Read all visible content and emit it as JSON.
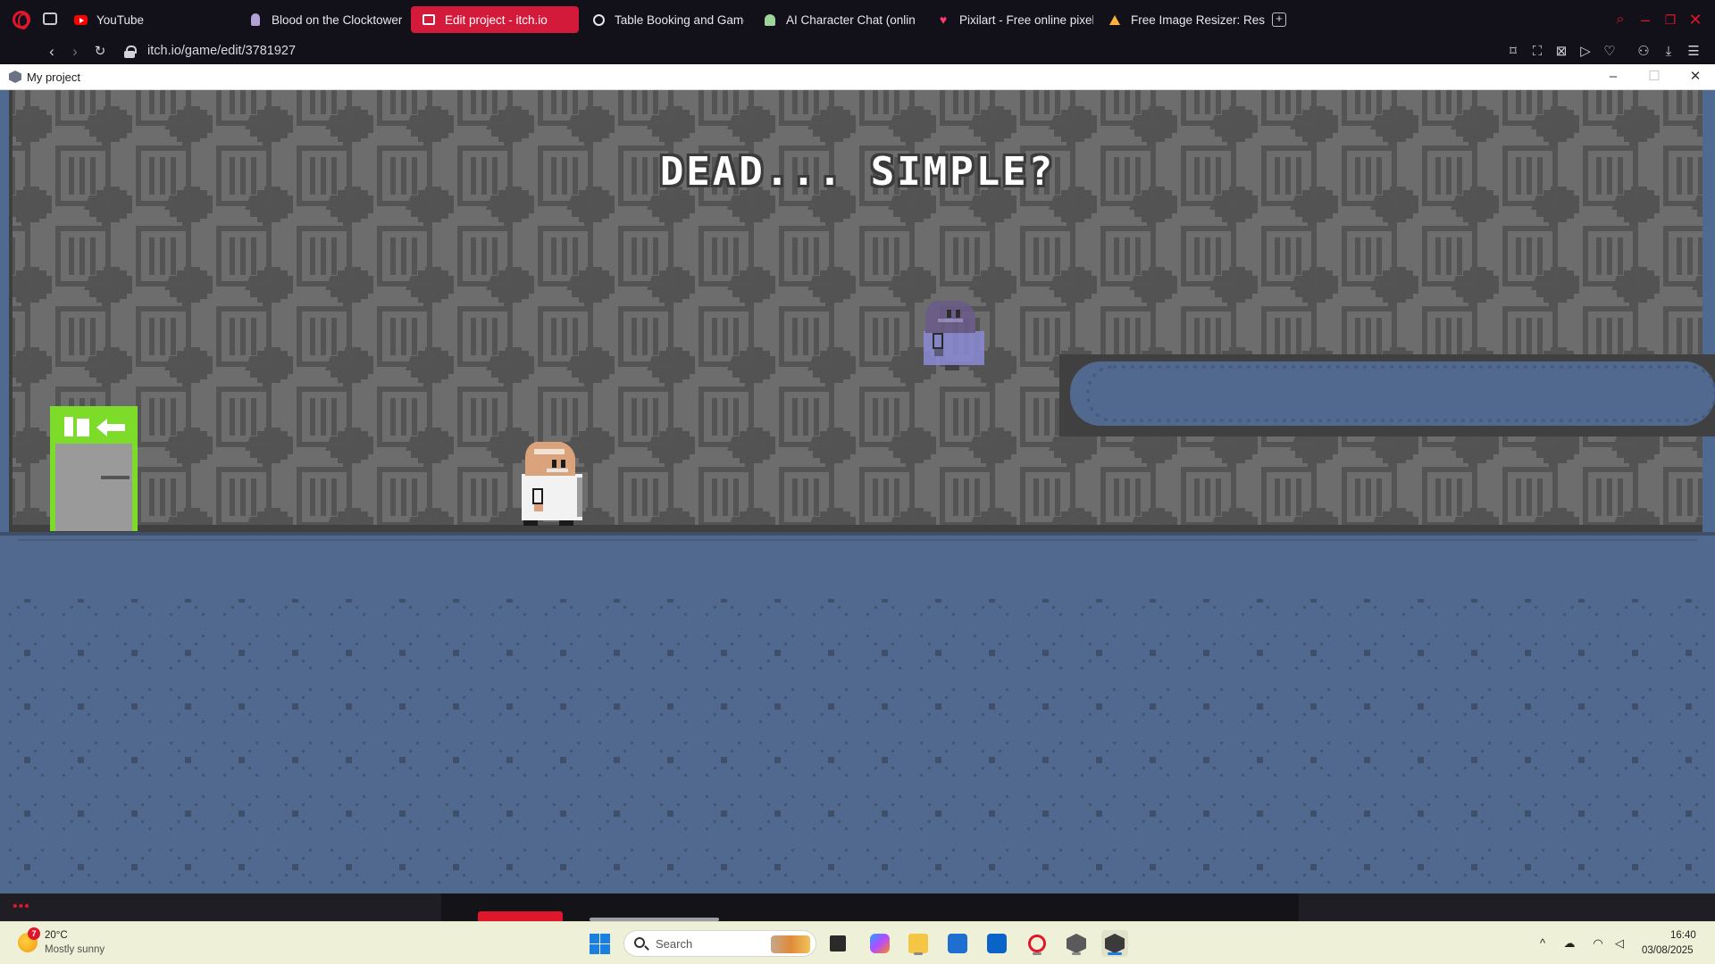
{
  "browser": {
    "tabs": [
      {
        "title": "YouTube",
        "icon": "youtube-icon",
        "color": "#ff0000",
        "active": false
      },
      {
        "title": "Blood on the Clocktower",
        "icon": "clocktower-icon",
        "color": "#b3a1d6",
        "active": false
      },
      {
        "title": "Edit project - itch.io",
        "icon": "itchio-icon",
        "color": "#ffffff",
        "active": true
      },
      {
        "title": "Table Booking and Game",
        "icon": "globe-icon",
        "color": "#e7e7ef",
        "active": false
      },
      {
        "title": "AI Character Chat (online",
        "icon": "character-chat-icon",
        "color": "#9ed39a",
        "active": false
      },
      {
        "title": "Pixilart - Free online pixel",
        "icon": "heart-icon",
        "color": "#ff3b6b",
        "active": false
      },
      {
        "title": "Free Image Resizer: Resiz",
        "icon": "resizer-icon",
        "color": "#ffb13b",
        "active": false
      }
    ],
    "url": "itch.io/game/edit/3781927",
    "accent": "#d41a3b"
  },
  "game_window": {
    "title": "My project",
    "heading": "DEAD... SIMPLE?",
    "colors": {
      "wall": "#6d6d6d",
      "wall_pattern": "#545454",
      "floor": "#51698f",
      "exit_sign": "#7ddb2a",
      "door": "#9a9a9a"
    },
    "characters": [
      {
        "name": "scientist-player",
        "icon": "scientist-sprite-icon"
      },
      {
        "name": "ghost-scientist",
        "icon": "ghost-sprite-icon"
      }
    ]
  },
  "taskbar": {
    "weather": {
      "badge": "7",
      "temp": "20°C",
      "desc": "Mostly sunny"
    },
    "search_placeholder": "Search",
    "clock": {
      "time": "16:40",
      "date": "03/08/2025"
    }
  }
}
